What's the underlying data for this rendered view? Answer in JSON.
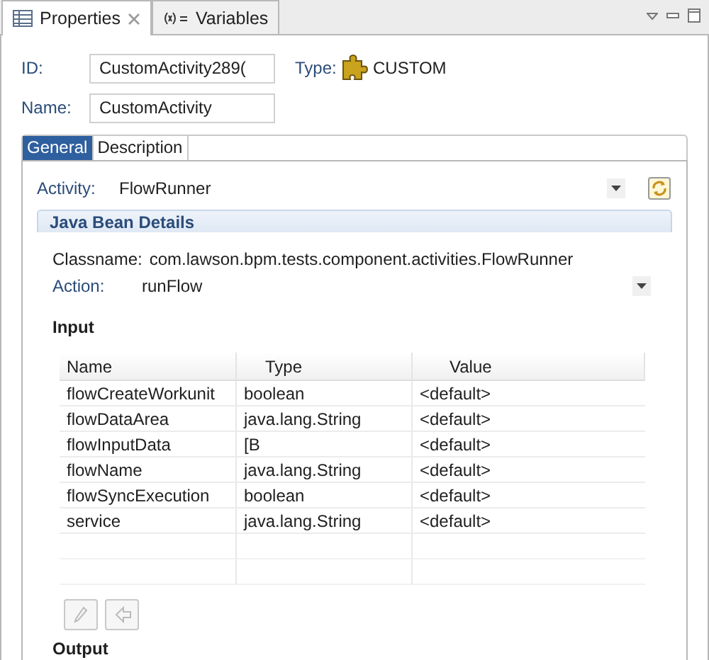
{
  "view_tabs": [
    {
      "label": "Properties",
      "closable": true,
      "selected": true
    },
    {
      "label": "Variables",
      "closable": false,
      "selected": false
    }
  ],
  "header": {
    "id_label": "ID:",
    "id_value": "CustomActivity289(",
    "name_label": "Name:",
    "name_value": "CustomActivity",
    "type_label": "Type:",
    "type_value": "CUSTOM"
  },
  "inner_tabs": [
    {
      "label": "General",
      "selected": true
    },
    {
      "label": "Description",
      "selected": false
    }
  ],
  "activity": {
    "label": "Activity:",
    "value": "FlowRunner"
  },
  "section": {
    "title": "Java Bean Details",
    "classname_label": "Classname:",
    "classname_value": "com.lawson.bpm.tests.component.activities.FlowRunner",
    "action_label": "Action:",
    "action_value": "runFlow"
  },
  "input": {
    "title": "Input",
    "columns": [
      "Name",
      "Type",
      "Value"
    ],
    "rows": [
      [
        "flowCreateWorkunit",
        "boolean",
        "<default>"
      ],
      [
        "flowDataArea",
        "java.lang.String",
        "<default>"
      ],
      [
        "flowInputData",
        "[B",
        "<default>"
      ],
      [
        "flowName",
        "java.lang.String",
        "<default>"
      ],
      [
        "flowSyncExecution",
        "boolean",
        "<default>"
      ],
      [
        "service",
        "java.lang.String",
        "<default>"
      ]
    ],
    "buttons": [
      {
        "kind": "edit",
        "disabled": true
      },
      {
        "kind": "reset",
        "disabled": true
      }
    ]
  },
  "output": {
    "title": "Output"
  }
}
